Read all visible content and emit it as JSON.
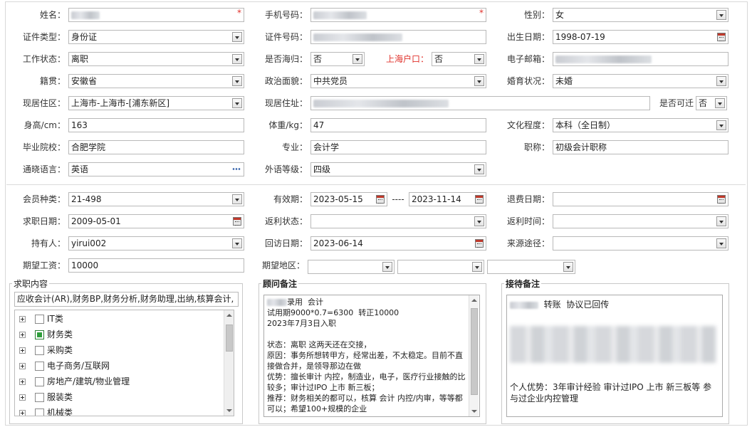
{
  "personal": {
    "name_label": "姓名：",
    "phone_label": "手机号码：",
    "gender_label": "性别：",
    "gender_value": "女",
    "id_type_label": "证件类型：",
    "id_type_value": "身份证",
    "id_no_label": "证件号码：",
    "birth_label": "出生日期：",
    "birth_value": "1998-07-19",
    "work_status_label": "工作状态：",
    "work_status_value": "离职",
    "overseas_label": "是否海归：",
    "overseas_value": "否",
    "hukou_label": "上海户口：",
    "hukou_value": "否",
    "email_label": "电子邮箱：",
    "origin_label": "籍贯：",
    "origin_value": "安徽省",
    "political_label": "政治面貌：",
    "political_value": "中共党员",
    "marital_label": "婚育状况：",
    "marital_value": "未婚",
    "region_label": "现居住区：",
    "region_value": "上海市-上海市-[浦东新区]",
    "address_label": "现居住址：",
    "relocate_label": "是否可迁",
    "relocate_value": "否",
    "height_label": "身高/cm：",
    "height_value": "163",
    "weight_label": "体重/kg：",
    "weight_value": "47",
    "education_label": "文化程度：",
    "education_value": "本科（全日制）",
    "school_label": "毕业院校：",
    "school_value": "合肥学院",
    "major_label": "专业：",
    "major_value": "会计学",
    "title_label": "职称：",
    "title_value": "初级会计职称",
    "language_label": "通晓语言：",
    "language_value": "英语",
    "lang_level_label": "外语等级：",
    "lang_level_value": "四级"
  },
  "member": {
    "type_label": "会员种类：",
    "type_value": "21-498",
    "valid_label": "有效期：",
    "valid_from": "2023-05-15",
    "valid_sep": "----",
    "valid_to": "2023-11-14",
    "refund_date_label": "退费日期：",
    "job_date_label": "求职日期：",
    "job_date_value": "2009-05-01",
    "rebate_status_label": "返利状态：",
    "rebate_time_label": "返利时间：",
    "holder_label": "持有人：",
    "holder_value": "yirui002",
    "visit_date_label": "回访日期：",
    "visit_date_value": "2023-06-14",
    "source_label": "来源途径：",
    "salary_label": "期望工资：",
    "salary_value": "10000",
    "area_label": "期望地区："
  },
  "job_content": {
    "title": "求职内容",
    "summary": "应收会计(AR),财务BP,财务分析,财务助理,出纳,核算会计,",
    "tree": [
      {
        "label": "IT类",
        "checked": false
      },
      {
        "label": "财务类",
        "checked": true
      },
      {
        "label": "采购类",
        "checked": false
      },
      {
        "label": "电子商务/互联网",
        "checked": false
      },
      {
        "label": "房地产/建筑/物业管理",
        "checked": false
      },
      {
        "label": "服装类",
        "checked": false
      },
      {
        "label": "机械类",
        "checked": false
      }
    ]
  },
  "advisor_note": {
    "title": "顾问备注",
    "line1": "录用  会计",
    "text": "试用期9000*0.7=6300  转正10000\n2023年7月3日入职\n\n状态：离职 这两天还在交接，\n原因：事务所想转甲方，经常出差，不太稳定。目前不直接做合并，是领导那边在做\n优势：擅长审计 内控，制造业，电子，医疗行业接触的比较多；审计过IPO 上市 新三板；\n推荐：财务相关的都可以，核算 会计 内控/内审，等等都可以；希望100+规模的企业"
  },
  "reception_note": {
    "title": "接待备注",
    "line1": "转账  协议已回传",
    "text": "个人优势：3年审计经验 审计过IPO 上市 新三板等 参与过企业内控管理"
  },
  "colors": {
    "required": "#e0312b",
    "checked": "#2e9e3a"
  }
}
